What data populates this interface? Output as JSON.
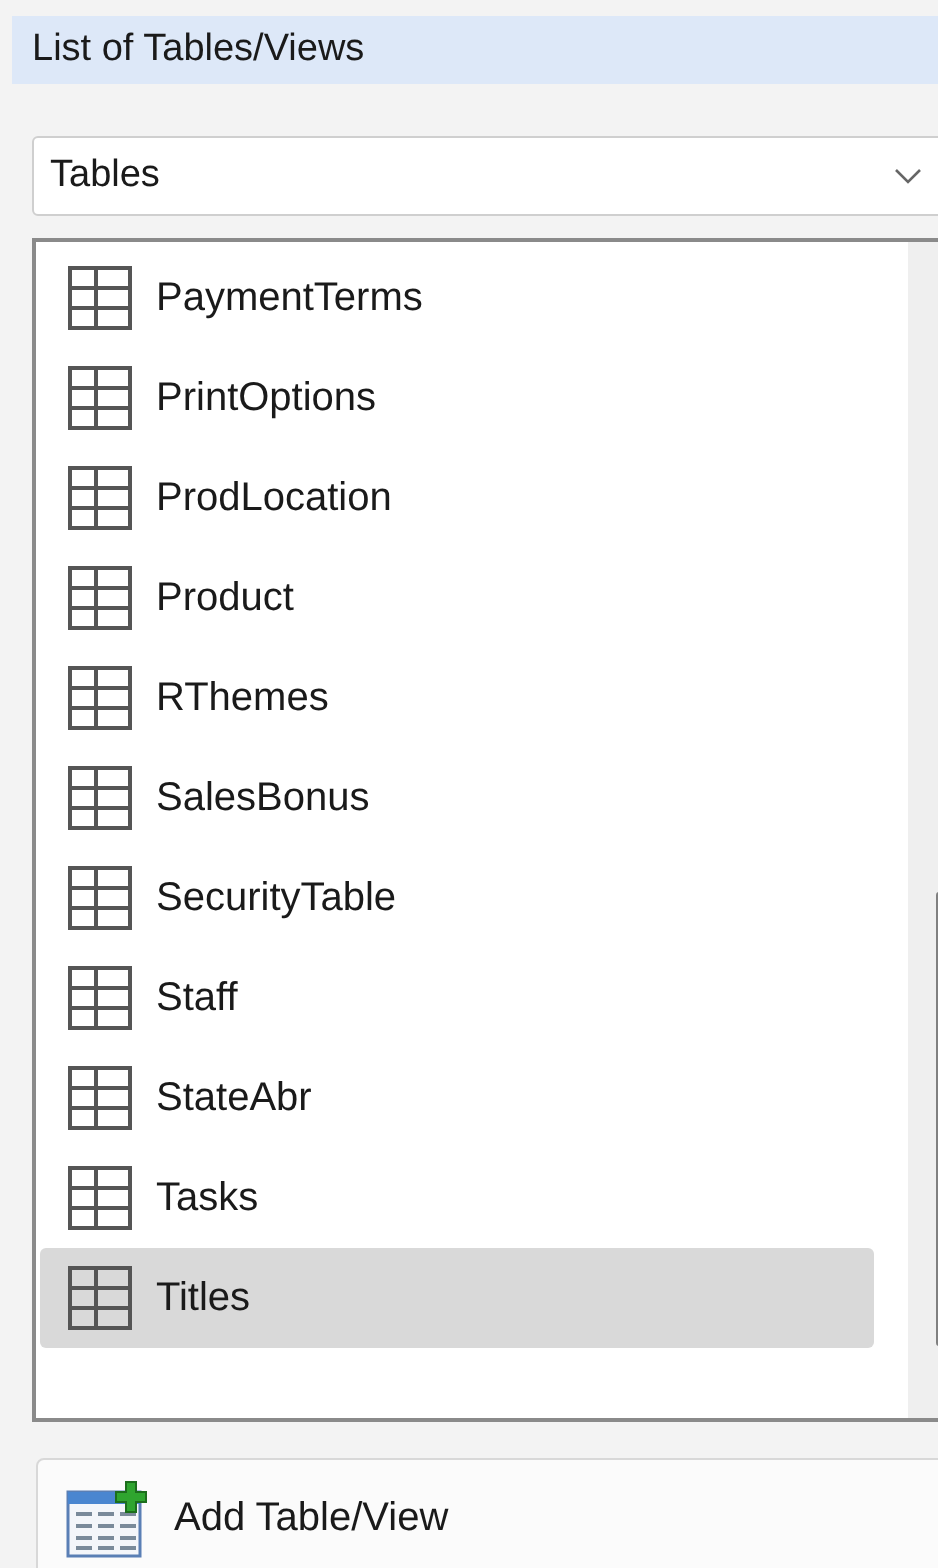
{
  "header": {
    "title": "List of Tables/Views"
  },
  "dropdown": {
    "value": "Tables"
  },
  "items": [
    {
      "label": "PaymentTerms",
      "selected": false
    },
    {
      "label": "PrintOptions",
      "selected": false
    },
    {
      "label": "ProdLocation",
      "selected": false
    },
    {
      "label": "Product",
      "selected": false
    },
    {
      "label": "RThemes",
      "selected": false
    },
    {
      "label": "SalesBonus",
      "selected": false
    },
    {
      "label": "SecurityTable",
      "selected": false
    },
    {
      "label": "Staff",
      "selected": false
    },
    {
      "label": "StateAbr",
      "selected": false
    },
    {
      "label": "Tasks",
      "selected": false
    },
    {
      "label": "Titles",
      "selected": true
    }
  ],
  "add_button": {
    "label": "Add Table/View"
  }
}
